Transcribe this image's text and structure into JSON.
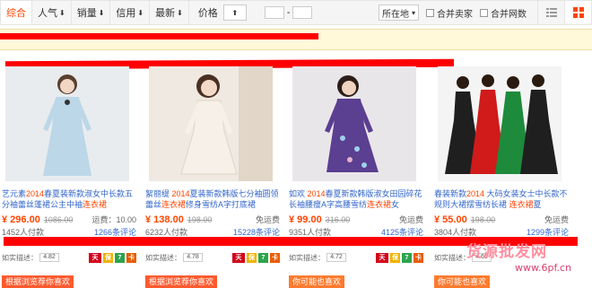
{
  "toolbar": {
    "sort_items": [
      {
        "label": "综合",
        "arrow": "",
        "active": true
      },
      {
        "label": "人气",
        "arrow": "⬇",
        "active": false
      },
      {
        "label": "销量",
        "arrow": "⬇",
        "active": false
      },
      {
        "label": "信用",
        "arrow": "⬇",
        "active": false
      },
      {
        "label": "最新",
        "arrow": "⬇",
        "active": false
      }
    ],
    "price_label": "价格",
    "price_sort_arrow": "⬆",
    "price_dash": "-",
    "location_label": "所在地",
    "merge_sellers_label": "合并卖家",
    "merge_stores_label": "合并网数"
  },
  "products": [
    {
      "title_pre": "艺元素",
      "title_hl1": "2014",
      "title_mid": "春夏装新款淑女中长款五分袖蕾丝蓬裙公主中袖",
      "title_hl2": "连衣裙",
      "title_post": "",
      "price": "¥ 296.00",
      "old_price": "1086.00",
      "shipping": "运费：10.00",
      "sales": "1452人付款",
      "reviews": "1266条评论",
      "rating_label": "如实描述：",
      "rating_value": "4.82",
      "tag": "根据浏览荐你喜欢",
      "img_bg": "#e8ecef",
      "dress": "#bcd7e8"
    },
    {
      "title_pre": "絮丽缇 ",
      "title_hl1": "2014",
      "title_mid": "夏装新款韩版七分袖圆领蕾丝",
      "title_hl2": "连衣裙",
      "title_post": "修身雪纺A字打底裙",
      "price": "¥ 138.00",
      "old_price": "198.00",
      "shipping": "免运费",
      "sales": "6232人付款",
      "reviews": "15228条评论",
      "rating_label": "如实描述：",
      "rating_value": "4.78",
      "tag": "根据浏览荐你喜欢",
      "img_bg": "#efe9e2",
      "dress": "#f6f0e8"
    },
    {
      "title_pre": "如欢 ",
      "title_hl1": "2014",
      "title_mid": "春夏新款韩版淑女田园碎花长袖腰瘦A字高腰雪纺",
      "title_hl2": "连衣裙",
      "title_post": "女",
      "price": "¥ 99.00",
      "old_price": "316.00",
      "shipping": "免运费",
      "sales": "9351人付款",
      "reviews": "4125条评论",
      "rating_label": "如实描述：",
      "rating_value": "4.72",
      "tag": "你可能也喜欢",
      "img_bg": "#e9e6ea",
      "dress": "#5b3f91"
    },
    {
      "title_pre": "春装新款",
      "title_hl1": "2014",
      "title_mid": " 大码女装女士中长款不规则大裙摆雪纺长裙 ",
      "title_hl2": "连衣裙",
      "title_post": "夏",
      "price": "¥ 55.00",
      "old_price": "198.00",
      "shipping": "免运费",
      "sales": "3804人付款",
      "reviews": "1299条评论",
      "rating_label": "如实描述：",
      "rating_value": "4.65",
      "tag": "你可能也喜欢",
      "img_bg": "#f4f4f4",
      "dress": "#1f1f1f"
    }
  ],
  "watermark": {
    "line1": "货源批发网",
    "line2": "www.6pf.cn"
  },
  "colors": {
    "accent": "#ff4400",
    "link": "#3366cc",
    "redact": "#ff0000",
    "notice_bg": "#fff8d9"
  }
}
